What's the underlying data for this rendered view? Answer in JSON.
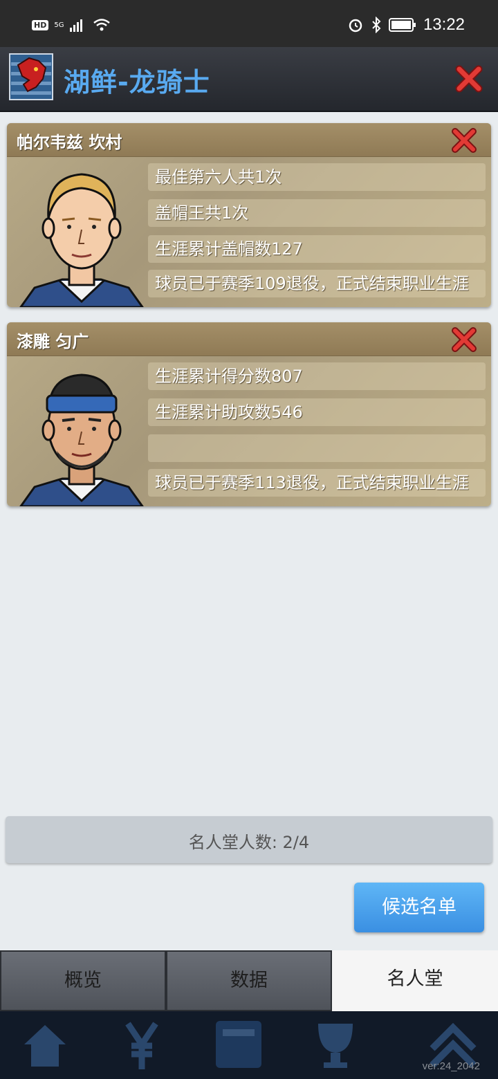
{
  "status_bar": {
    "left_badges": [
      "HD",
      "5G"
    ],
    "time": "13:22"
  },
  "header": {
    "title": "湖鲜-龙骑士"
  },
  "players": [
    {
      "name": "帕尔韦兹 坎村",
      "stats": [
        "最佳第六人共1次",
        "盖帽王共1次",
        "生涯累计盖帽数127",
        "球员已于赛季109退役，正式结束职业生涯"
      ]
    },
    {
      "name": "漆雕 匀广",
      "stats": [
        "生涯累计得分数807",
        "生涯累计助攻数546",
        "",
        "球员已于赛季113退役，正式结束职业生涯"
      ]
    }
  ],
  "hall": {
    "label": "名人堂人数:  2/4"
  },
  "candidate_button": "候选名单",
  "tabs": [
    {
      "label": "概览",
      "active": false
    },
    {
      "label": "数据",
      "active": false
    },
    {
      "label": "名人堂",
      "active": true
    }
  ],
  "version": "ver:24_2042",
  "colors": {
    "title_blue": "#59aaf0",
    "button_blue": "#4aa2ee",
    "close_red": "#d8262a",
    "card_tan": "#b3a581"
  }
}
